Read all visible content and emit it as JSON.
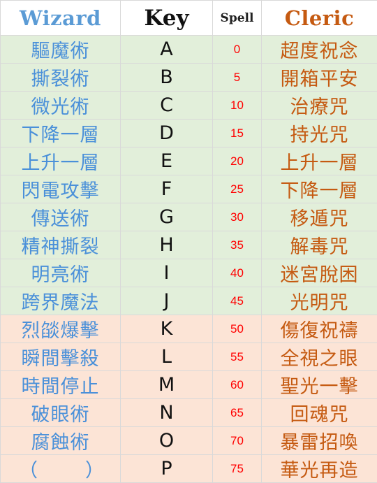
{
  "headers": {
    "wizard": "Wizard",
    "key": "Key",
    "spell": "Spell",
    "cleric": "Cleric"
  },
  "colors": {
    "wizard_text": "#4a90d9",
    "cleric_text": "#c55a11",
    "spell_text": "#ff0000",
    "green_band": "#e2efda",
    "pink_band": "#fce4d6"
  },
  "rows": [
    {
      "wizard": "驅魔術",
      "key": "A",
      "spell": "0",
      "cleric": "超度祝念",
      "band": "green"
    },
    {
      "wizard": "撕裂術",
      "key": "B",
      "spell": "5",
      "cleric": "開箱平安",
      "band": "green"
    },
    {
      "wizard": "微光術",
      "key": "C",
      "spell": "10",
      "cleric": "治療咒",
      "band": "green"
    },
    {
      "wizard": "下降一層",
      "key": "D",
      "spell": "15",
      "cleric": "持光咒",
      "band": "green"
    },
    {
      "wizard": "上升一層",
      "key": "E",
      "spell": "20",
      "cleric": "上升一層",
      "band": "green"
    },
    {
      "wizard": "閃電攻擊",
      "key": "F",
      "spell": "25",
      "cleric": "下降一層",
      "band": "green"
    },
    {
      "wizard": "傳送術",
      "key": "G",
      "spell": "30",
      "cleric": "移遁咒",
      "band": "green"
    },
    {
      "wizard": "精神撕裂",
      "key": "H",
      "spell": "35",
      "cleric": "解毒咒",
      "band": "green"
    },
    {
      "wizard": "明亮術",
      "key": "I",
      "spell": "40",
      "cleric": "迷宮脫困",
      "band": "green"
    },
    {
      "wizard": "跨界魔法",
      "key": "J",
      "spell": "45",
      "cleric": "光明咒",
      "band": "green"
    },
    {
      "wizard": "烈燄爆擊",
      "key": "K",
      "spell": "50",
      "cleric": "傷復祝禱",
      "band": "pink"
    },
    {
      "wizard": "瞬間擊殺",
      "key": "L",
      "spell": "55",
      "cleric": "全視之眼",
      "band": "pink"
    },
    {
      "wizard": "時間停止",
      "key": "M",
      "spell": "60",
      "cleric": "聖光一擊",
      "band": "pink"
    },
    {
      "wizard": "破眼術",
      "key": "N",
      "spell": "65",
      "cleric": "回魂咒",
      "band": "pink"
    },
    {
      "wizard": "腐蝕術",
      "key": "O",
      "spell": "70",
      "cleric": "暴雷招喚",
      "band": "pink"
    },
    {
      "wizard_paren_left": "（",
      "wizard_paren_right": "）",
      "key": "P",
      "spell": "75",
      "cleric": "華光再造",
      "band": "pink"
    }
  ]
}
